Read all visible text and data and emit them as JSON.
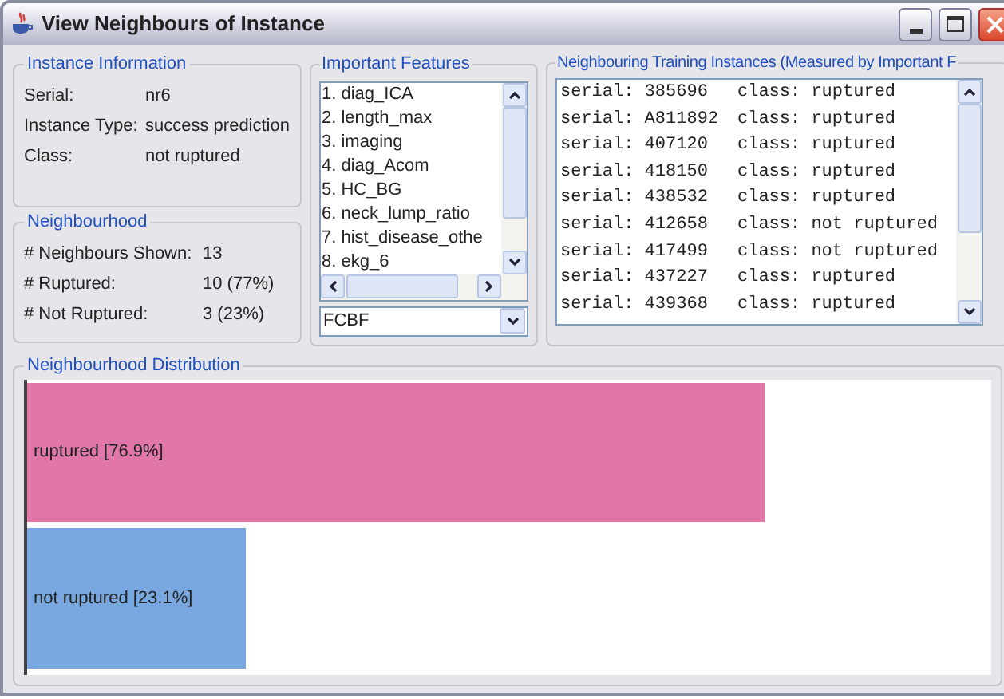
{
  "window": {
    "title": "View Neighbours of Instance"
  },
  "instance_information": {
    "title": "Instance Information",
    "fields": [
      {
        "label": "Serial:",
        "value": "nr6"
      },
      {
        "label": "Instance Type:",
        "value": "success prediction"
      },
      {
        "label": "Class:",
        "value": "not ruptured"
      }
    ]
  },
  "neighbourhood": {
    "title": "Neighbourhood",
    "fields": [
      {
        "label": "# Neighbours Shown:",
        "value": "13"
      },
      {
        "label": "# Ruptured:",
        "value": "10 (77%)"
      },
      {
        "label": "# Not Ruptured:",
        "value": "3 (23%)"
      }
    ]
  },
  "important_features": {
    "title": "Important Features",
    "items": [
      "1. diag_ICA",
      "2. length_max",
      "3. imaging",
      "4. diag_Acom",
      "5. HC_BG",
      "6. neck_lump_ratio",
      "7. hist_disease_othe",
      "8. ekg_6"
    ],
    "method": "FCBF"
  },
  "neighbouring_instances": {
    "title": "Neighbouring Training Instances (Measured by Important F",
    "rows": [
      {
        "serial": "serial: 385696",
        "class": "class: ruptured"
      },
      {
        "serial": "serial: A811892",
        "class": "class: ruptured"
      },
      {
        "serial": "serial: 407120",
        "class": "class: ruptured"
      },
      {
        "serial": "serial: 418150",
        "class": "class: ruptured"
      },
      {
        "serial": "serial: 438532",
        "class": "class: ruptured"
      },
      {
        "serial": "serial: 412658",
        "class": "class: not ruptured"
      },
      {
        "serial": "serial: 417499",
        "class": "class: not ruptured"
      },
      {
        "serial": "serial: 437227",
        "class": "class: ruptured"
      },
      {
        "serial": "serial: 439368",
        "class": "class: ruptured"
      }
    ]
  },
  "distribution": {
    "title": "Neighbourhood Distribution",
    "bars": [
      {
        "label": "ruptured [76.9%]",
        "level": 0.765,
        "color": "#e077a8"
      },
      {
        "label": "not ruptured [23.1%]",
        "level": 0.227,
        "color": "#79a8e0"
      }
    ]
  }
}
